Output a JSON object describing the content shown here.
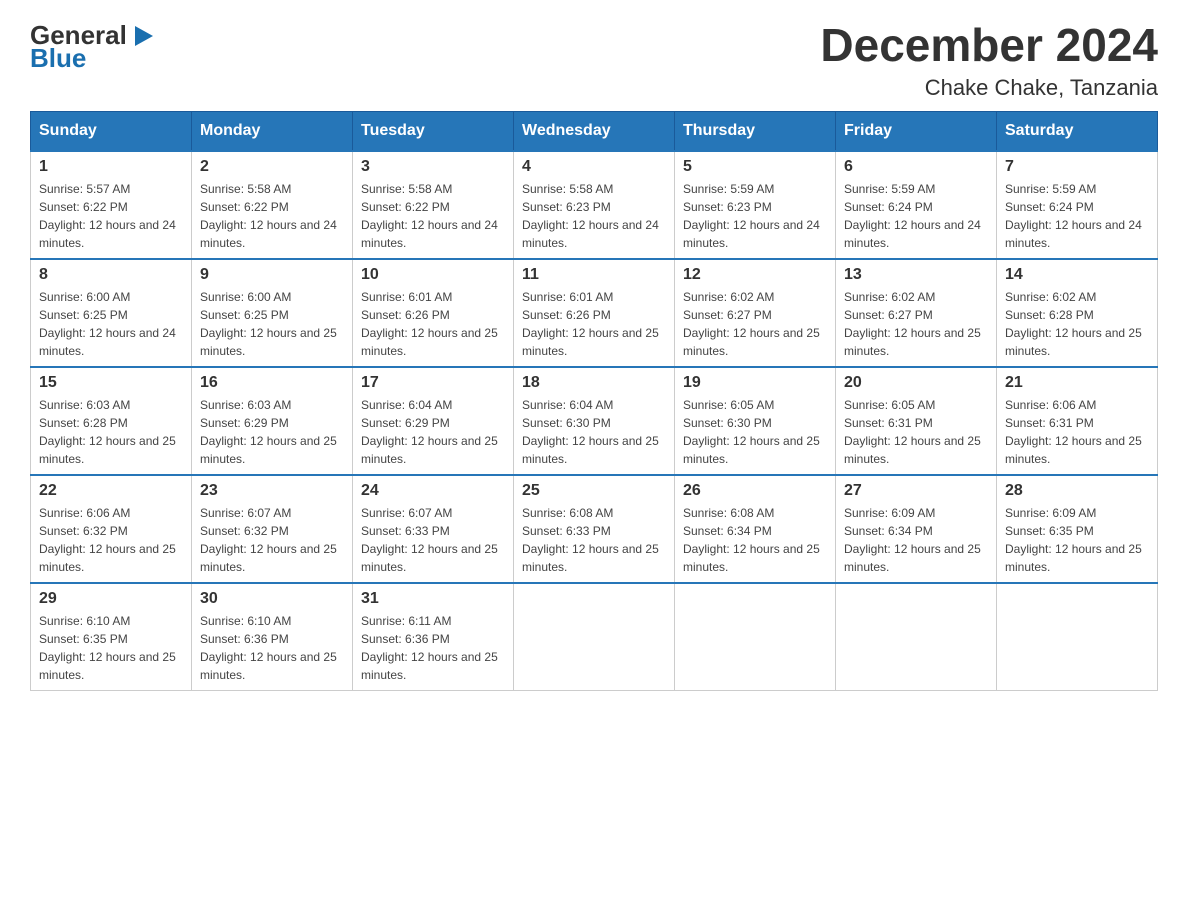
{
  "header": {
    "logo_general": "General",
    "logo_blue": "Blue",
    "title": "December 2024",
    "subtitle": "Chake Chake, Tanzania"
  },
  "weekdays": [
    "Sunday",
    "Monday",
    "Tuesday",
    "Wednesday",
    "Thursday",
    "Friday",
    "Saturday"
  ],
  "rows": [
    [
      {
        "day": "1",
        "sunrise": "5:57 AM",
        "sunset": "6:22 PM",
        "daylight": "12 hours and 24 minutes."
      },
      {
        "day": "2",
        "sunrise": "5:58 AM",
        "sunset": "6:22 PM",
        "daylight": "12 hours and 24 minutes."
      },
      {
        "day": "3",
        "sunrise": "5:58 AM",
        "sunset": "6:22 PM",
        "daylight": "12 hours and 24 minutes."
      },
      {
        "day": "4",
        "sunrise": "5:58 AM",
        "sunset": "6:23 PM",
        "daylight": "12 hours and 24 minutes."
      },
      {
        "day": "5",
        "sunrise": "5:59 AM",
        "sunset": "6:23 PM",
        "daylight": "12 hours and 24 minutes."
      },
      {
        "day": "6",
        "sunrise": "5:59 AM",
        "sunset": "6:24 PM",
        "daylight": "12 hours and 24 minutes."
      },
      {
        "day": "7",
        "sunrise": "5:59 AM",
        "sunset": "6:24 PM",
        "daylight": "12 hours and 24 minutes."
      }
    ],
    [
      {
        "day": "8",
        "sunrise": "6:00 AM",
        "sunset": "6:25 PM",
        "daylight": "12 hours and 24 minutes."
      },
      {
        "day": "9",
        "sunrise": "6:00 AM",
        "sunset": "6:25 PM",
        "daylight": "12 hours and 25 minutes."
      },
      {
        "day": "10",
        "sunrise": "6:01 AM",
        "sunset": "6:26 PM",
        "daylight": "12 hours and 25 minutes."
      },
      {
        "day": "11",
        "sunrise": "6:01 AM",
        "sunset": "6:26 PM",
        "daylight": "12 hours and 25 minutes."
      },
      {
        "day": "12",
        "sunrise": "6:02 AM",
        "sunset": "6:27 PM",
        "daylight": "12 hours and 25 minutes."
      },
      {
        "day": "13",
        "sunrise": "6:02 AM",
        "sunset": "6:27 PM",
        "daylight": "12 hours and 25 minutes."
      },
      {
        "day": "14",
        "sunrise": "6:02 AM",
        "sunset": "6:28 PM",
        "daylight": "12 hours and 25 minutes."
      }
    ],
    [
      {
        "day": "15",
        "sunrise": "6:03 AM",
        "sunset": "6:28 PM",
        "daylight": "12 hours and 25 minutes."
      },
      {
        "day": "16",
        "sunrise": "6:03 AM",
        "sunset": "6:29 PM",
        "daylight": "12 hours and 25 minutes."
      },
      {
        "day": "17",
        "sunrise": "6:04 AM",
        "sunset": "6:29 PM",
        "daylight": "12 hours and 25 minutes."
      },
      {
        "day": "18",
        "sunrise": "6:04 AM",
        "sunset": "6:30 PM",
        "daylight": "12 hours and 25 minutes."
      },
      {
        "day": "19",
        "sunrise": "6:05 AM",
        "sunset": "6:30 PM",
        "daylight": "12 hours and 25 minutes."
      },
      {
        "day": "20",
        "sunrise": "6:05 AM",
        "sunset": "6:31 PM",
        "daylight": "12 hours and 25 minutes."
      },
      {
        "day": "21",
        "sunrise": "6:06 AM",
        "sunset": "6:31 PM",
        "daylight": "12 hours and 25 minutes."
      }
    ],
    [
      {
        "day": "22",
        "sunrise": "6:06 AM",
        "sunset": "6:32 PM",
        "daylight": "12 hours and 25 minutes."
      },
      {
        "day": "23",
        "sunrise": "6:07 AM",
        "sunset": "6:32 PM",
        "daylight": "12 hours and 25 minutes."
      },
      {
        "day": "24",
        "sunrise": "6:07 AM",
        "sunset": "6:33 PM",
        "daylight": "12 hours and 25 minutes."
      },
      {
        "day": "25",
        "sunrise": "6:08 AM",
        "sunset": "6:33 PM",
        "daylight": "12 hours and 25 minutes."
      },
      {
        "day": "26",
        "sunrise": "6:08 AM",
        "sunset": "6:34 PM",
        "daylight": "12 hours and 25 minutes."
      },
      {
        "day": "27",
        "sunrise": "6:09 AM",
        "sunset": "6:34 PM",
        "daylight": "12 hours and 25 minutes."
      },
      {
        "day": "28",
        "sunrise": "6:09 AM",
        "sunset": "6:35 PM",
        "daylight": "12 hours and 25 minutes."
      }
    ],
    [
      {
        "day": "29",
        "sunrise": "6:10 AM",
        "sunset": "6:35 PM",
        "daylight": "12 hours and 25 minutes."
      },
      {
        "day": "30",
        "sunrise": "6:10 AM",
        "sunset": "6:36 PM",
        "daylight": "12 hours and 25 minutes."
      },
      {
        "day": "31",
        "sunrise": "6:11 AM",
        "sunset": "6:36 PM",
        "daylight": "12 hours and 25 minutes."
      },
      null,
      null,
      null,
      null
    ]
  ]
}
